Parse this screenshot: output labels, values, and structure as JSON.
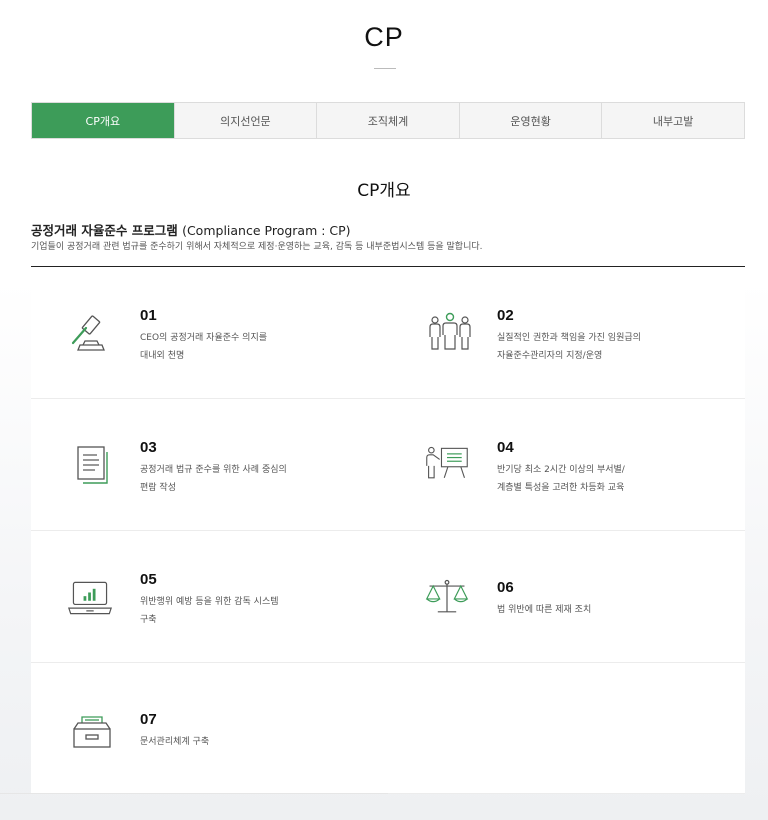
{
  "page": {
    "title": "CP"
  },
  "tabs": [
    {
      "label": "CP개요",
      "active": true
    },
    {
      "label": "의지선언문",
      "active": false
    },
    {
      "label": "조직체계",
      "active": false
    },
    {
      "label": "운영현황",
      "active": false
    },
    {
      "label": "내부고발",
      "active": false
    }
  ],
  "section": {
    "title": "CP개요",
    "program_name_ko": "공정거래 자율준수 프로그램",
    "program_name_en": "(Compliance Program : CP)",
    "description": "기업들이 공정거래 관련 법규를 준수하기 위해서 자체적으로 제정·운영하는 교육, 감독 등 내부준법시스템 등을 말합니다."
  },
  "items": [
    {
      "number": "01",
      "line1": "CEO의 공정거래 자율준수 의지를",
      "line2": "대내외 천명",
      "icon": "gavel-icon"
    },
    {
      "number": "02",
      "line1": "실질적인 권한과 책임을 가진 임원급의",
      "line2": "자율준수관리자의 지정/운영",
      "icon": "people-group-icon"
    },
    {
      "number": "03",
      "line1": "공정거래 법규 준수를 위한 사례 중심의",
      "line2": "편람 작성",
      "icon": "document-icon"
    },
    {
      "number": "04",
      "line1": "반기당 최소 2시간 이상의 부서별/",
      "line2": "계층별 특성을 고려한 차등화 교육",
      "icon": "presentation-icon"
    },
    {
      "number": "05",
      "line1": "위반행위 예방 등을 위한 감독 시스템",
      "line2": "구축",
      "icon": "laptop-chart-icon"
    },
    {
      "number": "06",
      "line1": "법 위반에 따른 제재 조치",
      "line2": "",
      "icon": "scales-icon"
    },
    {
      "number": "07",
      "line1": "문서관리체계 구축",
      "line2": "",
      "icon": "archive-box-icon"
    }
  ],
  "colors": {
    "accent": "#3d9c59",
    "icon_stroke": "#555555"
  }
}
